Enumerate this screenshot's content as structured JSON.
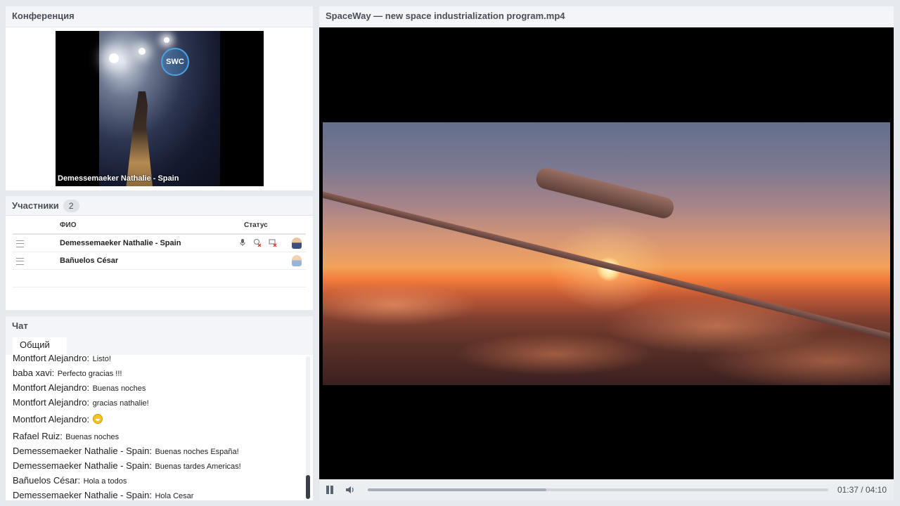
{
  "conference": {
    "title": "Конференция",
    "speaker_label": "Demessemaeker Nathalie - Spain",
    "logo_text": "SWC"
  },
  "participants": {
    "title": "Участники",
    "count": "2",
    "columns": {
      "name": "ФИО",
      "status": "Статус"
    },
    "rows": [
      {
        "name": "Demessemaeker Nathalie - Spain",
        "status_icons": [
          "mic-icon",
          "camera-off-icon",
          "screen-off-icon",
          "user-presenter-icon"
        ]
      },
      {
        "name": "Bañuelos  César",
        "status_icons": [
          "user-icon"
        ]
      }
    ]
  },
  "chat": {
    "title": "Чат",
    "tab": "Общий",
    "messages": [
      {
        "author": "Montfort Alejandro:",
        "text": "Listo!"
      },
      {
        "author": "baba  xavi:",
        "text": "Perfecto gracias !!!"
      },
      {
        "author": "Montfort Alejandro:",
        "text": "Buenas noches"
      },
      {
        "author": "Montfort Alejandro:",
        "text": "gracias nathalie!"
      },
      {
        "author": "Montfort Alejandro:",
        "text": "",
        "emoji": "grin-emoji"
      },
      {
        "author": "Rafael Ruiz:",
        "text": "Buenas noches"
      },
      {
        "author": "Demessemaeker Nathalie - Spain:",
        "text": "Buenas noches España!"
      },
      {
        "author": "Demessemaeker Nathalie - Spain:",
        "text": "Buenas tardes Americas!"
      },
      {
        "author": "Bañuelos  César:",
        "text": "Hola a todos"
      },
      {
        "author": "Demessemaeker Nathalie - Spain:",
        "text": "Hola Cesar"
      }
    ]
  },
  "player": {
    "title": "SpaceWay — new space industrialization program.mp4",
    "current_time": "01:37",
    "duration": "04:10",
    "time_display": "01:37 / 04:10",
    "progress_fraction": 0.388,
    "state": "playing"
  },
  "colors": {
    "panel_header_bg": "#f3f5f8",
    "page_bg": "#e6e9ed",
    "scroll_thumb": "#3a3f47"
  }
}
